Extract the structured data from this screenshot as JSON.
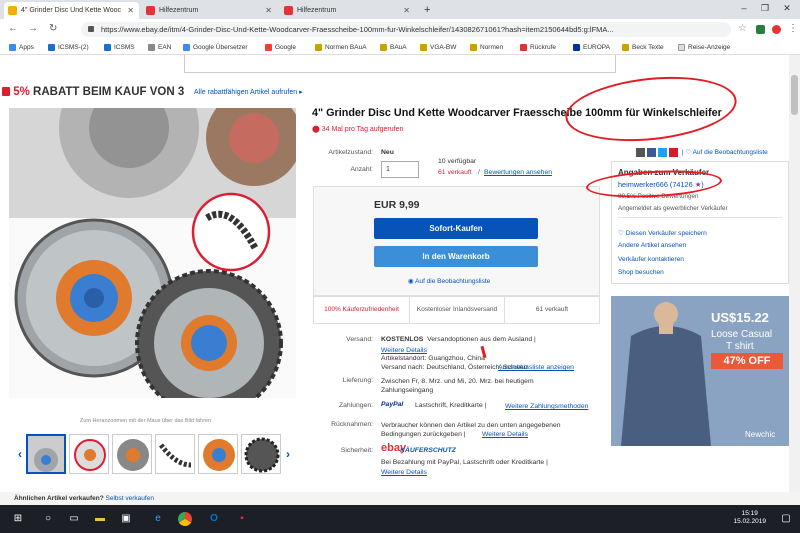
{
  "browser": {
    "tabs": [
      {
        "label": "4\" Grinder Disc Und Kette Wooc",
        "active": true
      },
      {
        "label": "Hilfezentrum",
        "active": false
      },
      {
        "label": "Hilfezentrum",
        "active": false
      }
    ],
    "new_tab": "+",
    "url": "https://www.ebay.de/itm/4-Grinder-Disc-Und-Kette-Woodcarver-Fraesscheibe-100mm-fur-Winkelschleifer/143082671061?hash=item2150644bd5:g:lFMA...",
    "window_controls": [
      "–",
      "❐",
      "✕"
    ],
    "bookmarks": [
      "Apps",
      "ICSMS-(2)",
      "ICSMS",
      "EAN",
      "Google Übersetzer",
      "Google",
      "Normen BAuA",
      "BAuA",
      "VGA-BW",
      "Normen",
      "Rückrufe",
      "EUROPA",
      "Beck Texte",
      "Reise-Anzeige"
    ]
  },
  "promo": {
    "percent": "5%",
    "text": "RABATT BEIM KAUF VON 3",
    "link": "Alle rabattfähigen Artikel aufrufen ▸"
  },
  "product": {
    "title": "4\" Grinder Disc Und Kette Woodcarver Fraesscheibe 100mm für Winkelschleifer",
    "sold_today": "34 Mal pro Tag aufgerufen",
    "social_link": "Auf die Beobachtungsliste",
    "condition_label": "Artikelzustand:",
    "condition_value": "Neu",
    "quantity_label": "Anzahl:",
    "quantity_value": "1",
    "available": "10 verfügbar",
    "sold_count": "61 verkauft",
    "reviews_link": "Bewertungen ansehen",
    "price": "EUR 9,99",
    "buy_now": "Sofort-Kaufen",
    "add_cart": "In den Warenkorb",
    "watch": "Auf die Beobachtungsliste",
    "info_cells": [
      "100% Käuferzufriedenheit",
      "Kostenloser Inlandsversand",
      "61 verkauft"
    ],
    "zoom_hint": "Zum Heranzoomen mit der Maus über das Bild fahren"
  },
  "seller": {
    "heading": "Angaben zum Verkäufer",
    "name": "heimwerker666",
    "score": "(74126",
    "star": "★",
    "score_close": ")",
    "positive": "99,5% Positive Bewertungen",
    "type": "Angemeldet als gewerblicher Verkäufer",
    "links": [
      "Diesen Verkäufer speichern",
      "Andere Artikel ansehen",
      "Verkäufer kontaktieren",
      "Shop besuchen"
    ]
  },
  "ad": {
    "price": "US$15.22",
    "line1": "Loose Casual",
    "line2": "T shirt",
    "discount": "47% OFF",
    "brand": "Newchic"
  },
  "details": {
    "shipping_label": "Versand:",
    "shipping_value": "KOSTENLOS",
    "shipping_options": "Versandoptionen aus dem Ausland |",
    "shipping_more": "Weitere Details",
    "item_location": "Artikelstandort: Guangzhou, China",
    "ships_to": "Versand nach: Deutschland, Österreich, Schweiz",
    "exclusions": "Ausschlussliste anzeigen",
    "delivery_label": "Lieferung:",
    "delivery_value": "Zwischen Fr, 8. Mrz. und Mi, 20. Mrz. bei heutigem Zahlungseingang",
    "payment_label": "Zahlungen:",
    "payment_paypal": "PayPal",
    "payment_value": "Lastschrift,  Kreditkarte  |",
    "payment_more": "Weitere Zahlungsmethoden",
    "returns_label": "Rücknahmen:",
    "returns_value": "Verbraucher können den Artikel zu den unten angegebenen Bedingungen zurückgeben |",
    "returns_more": "Weitere Details",
    "security_label": "Sicherheit:",
    "security_brand": "ebay",
    "security_title": "KÄUFERSCHUTZ",
    "security_text": "Bei Bezahlung mit PayPal, Lastschrift oder Kreditkarte |",
    "security_more": "Weitere Details"
  },
  "similar": {
    "text": "Ähnlichen Artikel verkaufen?",
    "link": "Selbst verkaufen"
  },
  "taskbar": {
    "time": "15:19",
    "date": "15.02.2019"
  },
  "colors": {
    "ebay_blue": "#0654ba",
    "ebay_red": "#dd1e31",
    "button_blue": "#3665f3"
  }
}
